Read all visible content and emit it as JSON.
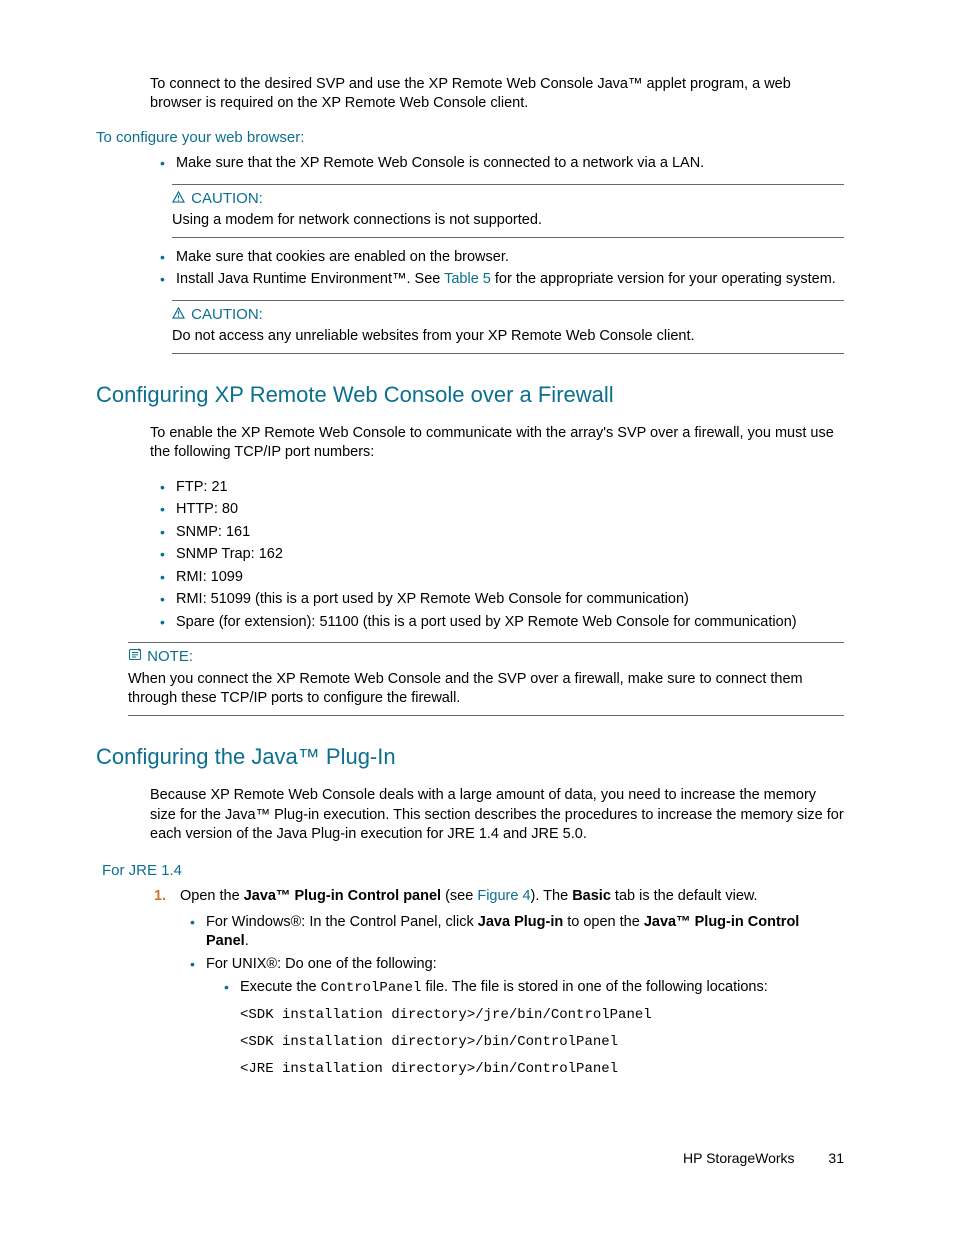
{
  "intro": "To connect to the desired SVP and use the XP Remote Web Console Java™ applet program, a web browser is required on the XP Remote Web Console client.",
  "configBrowser": {
    "heading": "To configure your web browser:",
    "b1": "Make sure that the XP Remote Web Console is connected to a network via a LAN.",
    "caution1": {
      "label": "CAUTION:",
      "body": "Using a modem for network connections is not supported."
    },
    "b2": "Make sure that cookies are enabled on the browser.",
    "b3a": "Install Java Runtime Environment™.  See ",
    "b3link": "Table 5",
    "b3b": " for the appropriate version for your operating system.",
    "caution2": {
      "label": "CAUTION:",
      "body": "Do not access any unreliable websites from your XP Remote Web Console client."
    }
  },
  "firewall": {
    "heading": "Configuring XP Remote Web Console over a Firewall",
    "p1": "To enable the XP Remote Web Console to communicate with the array's SVP over a firewall, you must use the following TCP/IP port numbers:",
    "ports": [
      "FTP: 21",
      "HTTP: 80",
      "SNMP: 161",
      "SNMP Trap: 162",
      "RMI: 1099",
      "RMI: 51099 (this is a port used by XP Remote Web Console for communication)",
      "Spare (for extension): 51100 (this is a port used by XP Remote Web Console for communication)"
    ],
    "note": {
      "label": "NOTE:",
      "body": "When you connect the XP Remote Web Console and the SVP over a firewall, make sure to connect them through these TCP/IP ports to configure the firewall."
    }
  },
  "java": {
    "heading": "Configuring the Java™ Plug-In",
    "p1": "Because XP Remote Web Console deals with a large amount of data, you need to increase the memory size for the Java™ Plug-in execution.  This section describes the procedures to increase the memory size for each version of the Java Plug-in execution for JRE 1.4 and JRE 5.0.",
    "jre14": {
      "heading": "For JRE 1.4",
      "step1": {
        "a": "Open the ",
        "b": "Java™ Plug-in Control panel",
        "c": " (see ",
        "link": "Figure 4",
        "d": ").  The ",
        "e": "Basic",
        "f": " tab is the default view."
      },
      "sub1": {
        "a": "For Windows®: In the Control Panel, click ",
        "b": "Java Plug-in",
        "c": " to open the ",
        "d": "Java™ Plug-in Control Panel",
        "e": "."
      },
      "sub2": "For UNIX®: Do one of the following:",
      "subsub1a": "Execute the ",
      "subsub1b": "ControlPanel",
      "subsub1c": " file.  The file is stored in one of the following locations:",
      "code": [
        "<SDK installation directory>/jre/bin/ControlPanel",
        "<SDK installation directory>/bin/ControlPanel",
        "<JRE installation directory>/bin/ControlPanel"
      ]
    }
  },
  "footer": {
    "brand": "HP StorageWorks",
    "page": "31"
  }
}
